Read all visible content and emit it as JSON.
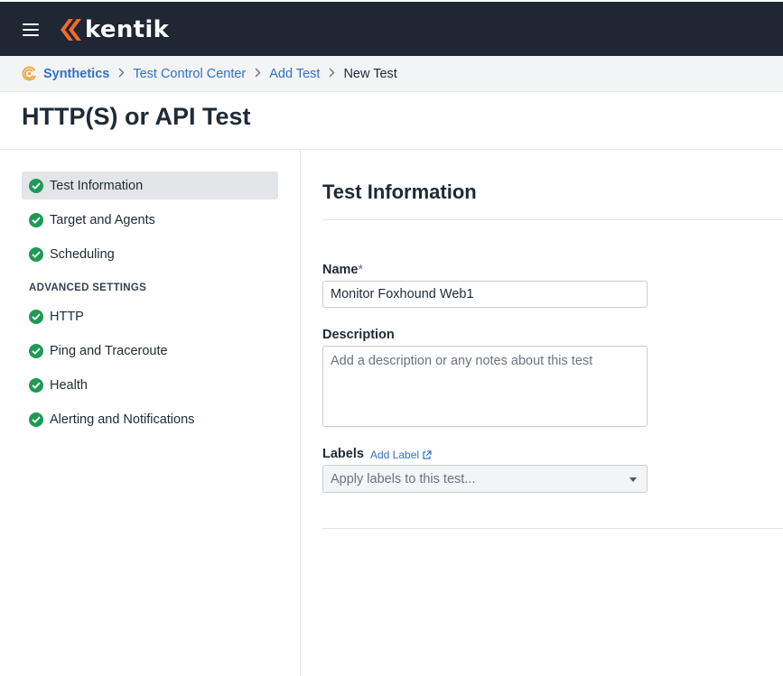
{
  "app": {
    "brand": "kentik",
    "menu_icon": "hamburger-menu-icon"
  },
  "breadcrumb": {
    "items": [
      {
        "label": "Synthetics",
        "icon": "synthetics-icon"
      },
      {
        "label": "Test Control Center"
      },
      {
        "label": "Add Test"
      },
      {
        "label": "New Test"
      }
    ]
  },
  "page": {
    "title": "HTTP(S) or API Test"
  },
  "sidebar": {
    "items": [
      {
        "label": "Test Information",
        "status": "complete",
        "active": true
      },
      {
        "label": "Target and Agents",
        "status": "complete"
      },
      {
        "label": "Scheduling",
        "status": "complete"
      }
    ],
    "advanced_heading": "ADVANCED SETTINGS",
    "advanced_items": [
      {
        "label": "HTTP",
        "status": "complete"
      },
      {
        "label": "Ping and Traceroute",
        "status": "complete"
      },
      {
        "label": "Health",
        "status": "complete"
      },
      {
        "label": "Alerting and Notifications",
        "status": "complete"
      }
    ]
  },
  "form": {
    "section_title": "Test Information",
    "name": {
      "label": "Name",
      "required_mark": "*",
      "value": "Monitor Foxhound Web1"
    },
    "description": {
      "label": "Description",
      "placeholder": "Add a description or any notes about this test",
      "value": ""
    },
    "labels": {
      "label": "Labels",
      "add_link": "Add Label",
      "placeholder": "Apply labels to this test..."
    }
  },
  "colors": {
    "topbar": "#1e2733",
    "brand_orange": "#f26b2b",
    "link": "#2f72c4",
    "check_green": "#1e9a54"
  }
}
